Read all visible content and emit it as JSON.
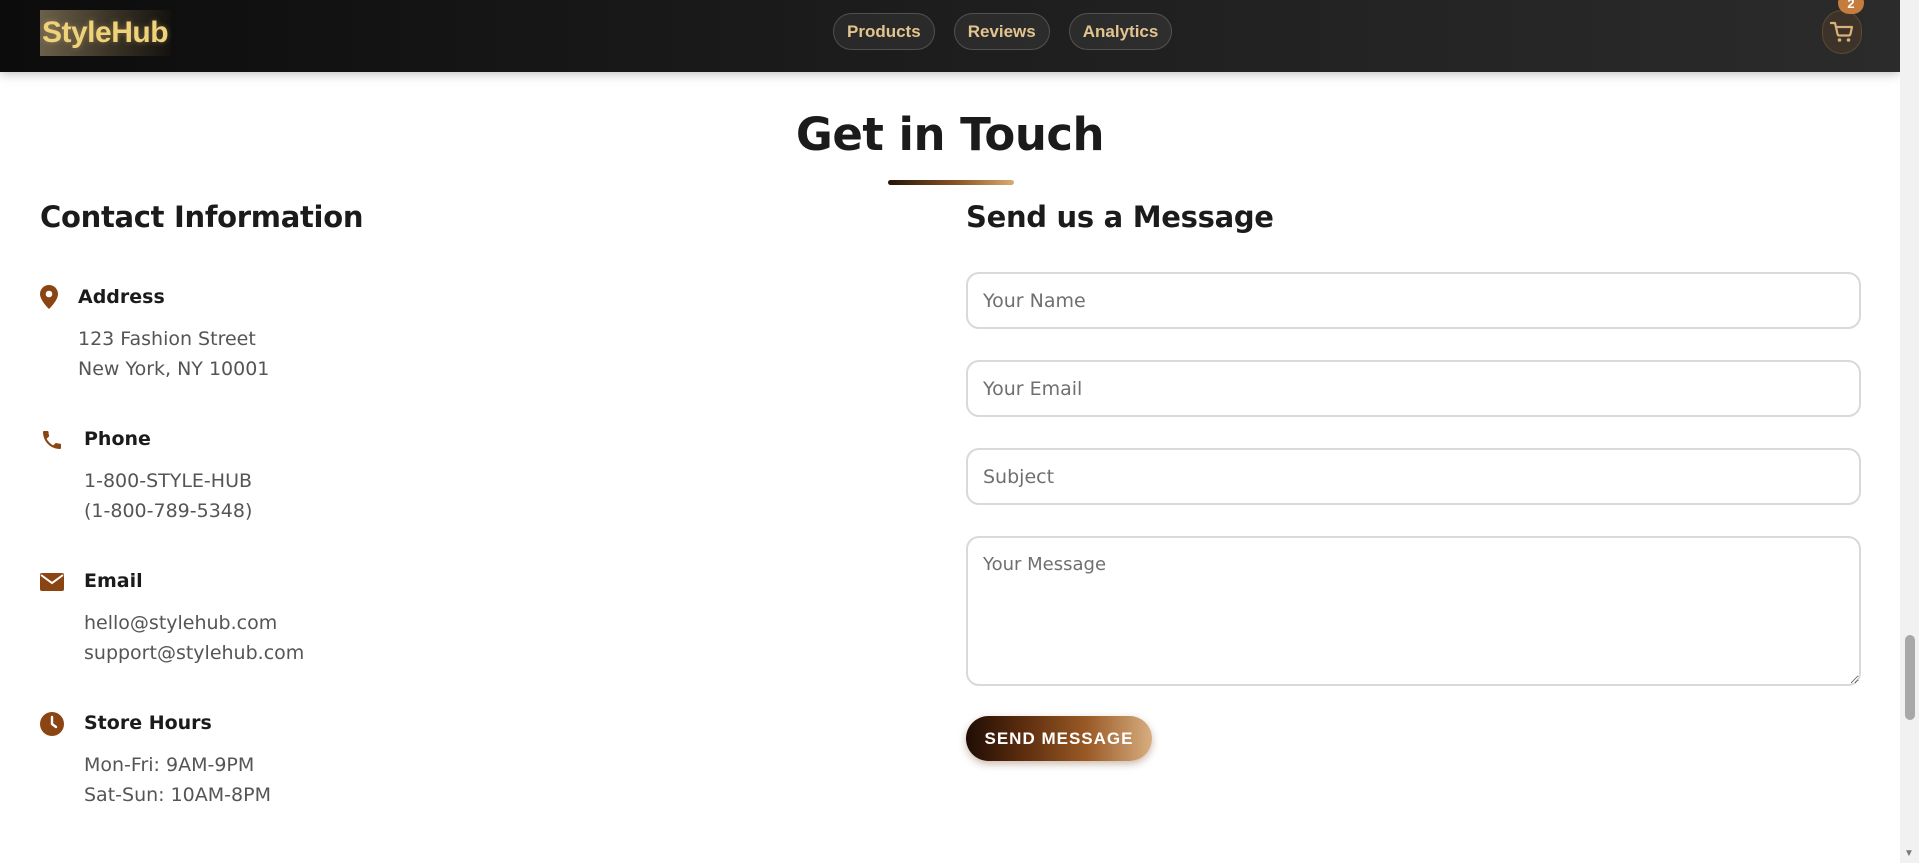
{
  "nav": {
    "logo": "StyleHub",
    "links": [
      "Products",
      "Reviews",
      "Analytics"
    ],
    "cart_count": "2"
  },
  "section": {
    "title": "Get in Touch"
  },
  "contact": {
    "heading": "Contact Information",
    "items": [
      {
        "icon": "map-pin-icon",
        "label": "Address",
        "lines": [
          "123 Fashion Street",
          "New York, NY 10001"
        ]
      },
      {
        "icon": "phone-icon",
        "label": "Phone",
        "lines": [
          "1-800-STYLE-HUB",
          "(1-800-789-5348)"
        ]
      },
      {
        "icon": "envelope-icon",
        "label": "Email",
        "lines": [
          "hello@stylehub.com",
          "support@stylehub.com"
        ]
      },
      {
        "icon": "clock-icon",
        "label": "Store Hours",
        "lines": [
          "Mon-Fri: 9AM-9PM",
          "Sat-Sun: 10AM-8PM"
        ]
      }
    ]
  },
  "form": {
    "heading": "Send us a Message",
    "name_placeholder": "Your Name",
    "email_placeholder": "Your Email",
    "subject_placeholder": "Subject",
    "message_placeholder": "Your Message",
    "submit_label": "SEND MESSAGE"
  },
  "colors": {
    "accent": "#8b4513",
    "nav_bg": "#1a1a1a",
    "nav_text": "#e2c48e",
    "badge": "#c47d3c"
  }
}
